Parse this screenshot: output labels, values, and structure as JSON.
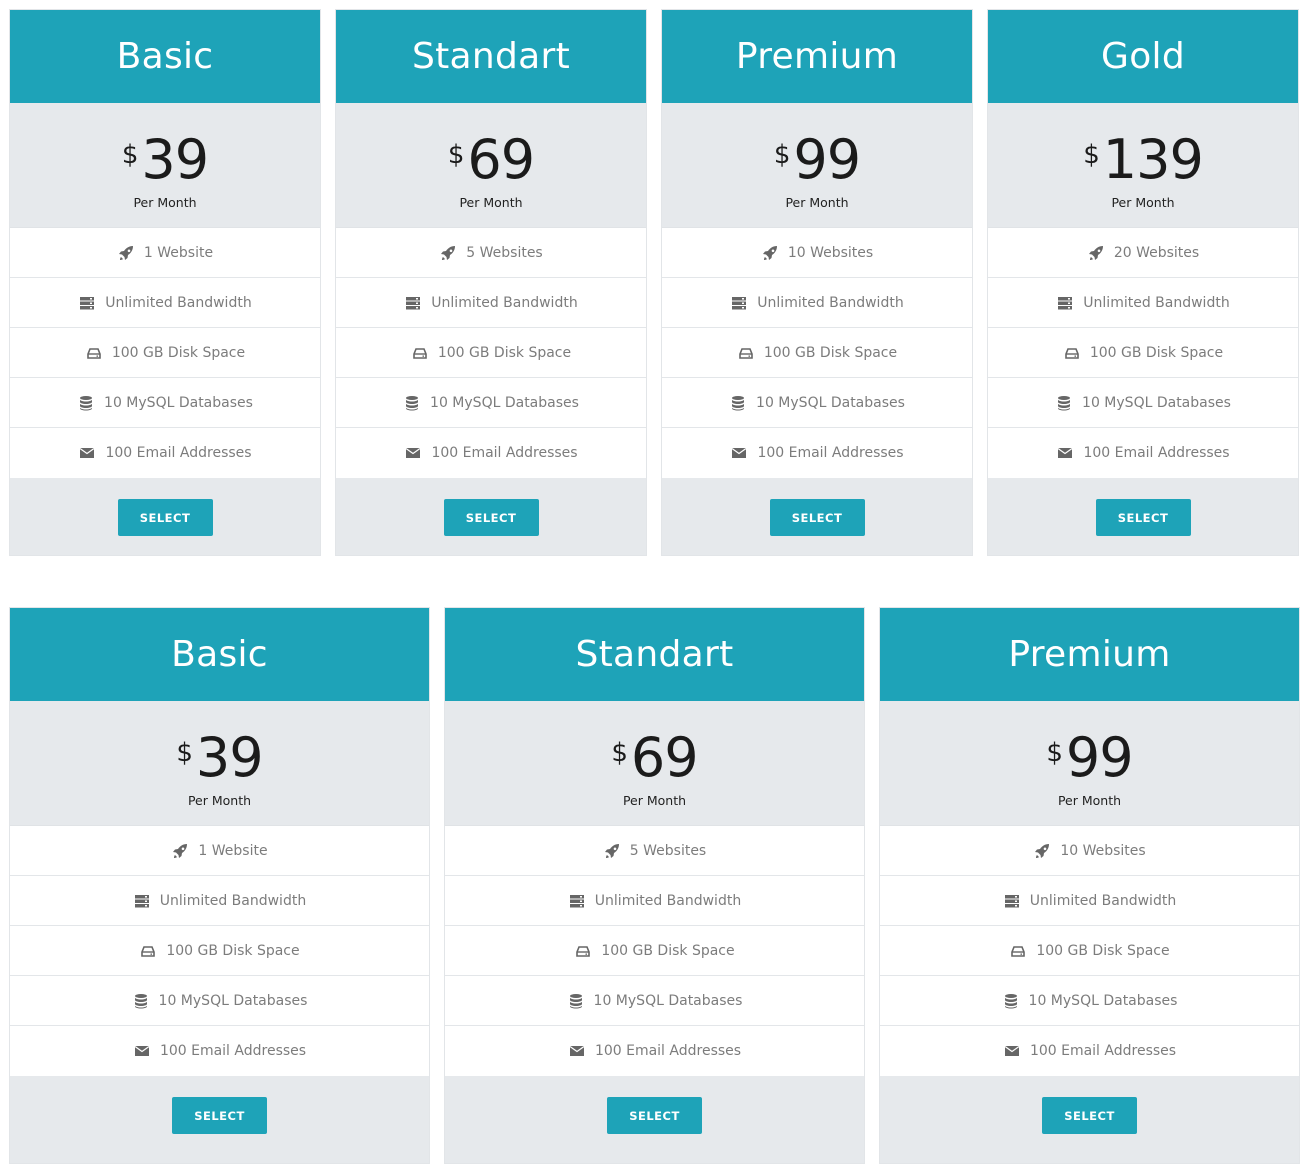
{
  "rows": [
    {
      "cards": [
        {
          "title": "Basic",
          "currency": "$",
          "amount": "39",
          "period": "Per Month",
          "features": [
            "1 Website",
            "Unlimited Bandwidth",
            "100 GB Disk Space",
            "10 MySQL Databases",
            "100 Email Addresses"
          ],
          "button": "SELECT"
        },
        {
          "title": "Standart",
          "currency": "$",
          "amount": "69",
          "period": "Per Month",
          "features": [
            "5 Websites",
            "Unlimited Bandwidth",
            "100 GB Disk Space",
            "10 MySQL Databases",
            "100 Email Addresses"
          ],
          "button": "SELECT"
        },
        {
          "title": "Premium",
          "currency": "$",
          "amount": "99",
          "period": "Per Month",
          "features": [
            "10 Websites",
            "Unlimited Bandwidth",
            "100 GB Disk Space",
            "10 MySQL Databases",
            "100 Email Addresses"
          ],
          "button": "SELECT"
        },
        {
          "title": "Gold",
          "currency": "$",
          "amount": "139",
          "period": "Per Month",
          "features": [
            "20 Websites",
            "Unlimited Bandwidth",
            "100 GB Disk Space",
            "10 MySQL Databases",
            "100 Email Addresses"
          ],
          "button": "SELECT"
        }
      ]
    },
    {
      "cards": [
        {
          "title": "Basic",
          "currency": "$",
          "amount": "39",
          "period": "Per Month",
          "features": [
            "1 Website",
            "Unlimited Bandwidth",
            "100 GB Disk Space",
            "10 MySQL Databases",
            "100 Email Addresses"
          ],
          "button": "SELECT"
        },
        {
          "title": "Standart",
          "currency": "$",
          "amount": "69",
          "period": "Per Month",
          "features": [
            "5 Websites",
            "Unlimited Bandwidth",
            "100 GB Disk Space",
            "10 MySQL Databases",
            "100 Email Addresses"
          ],
          "button": "SELECT"
        },
        {
          "title": "Premium",
          "currency": "$",
          "amount": "99",
          "period": "Per Month",
          "features": [
            "10 Websites",
            "Unlimited Bandwidth",
            "100 GB Disk Space",
            "10 MySQL Databases",
            "100 Email Addresses"
          ],
          "button": "SELECT"
        }
      ]
    }
  ],
  "feature_icons": [
    "rocket-icon",
    "server-icon",
    "hard-drive-icon",
    "database-icon",
    "envelope-icon"
  ],
  "colors": {
    "accent": "#1ea3b8",
    "card_bg": "#e6e9ec",
    "feature_text": "#7c7c7c"
  }
}
